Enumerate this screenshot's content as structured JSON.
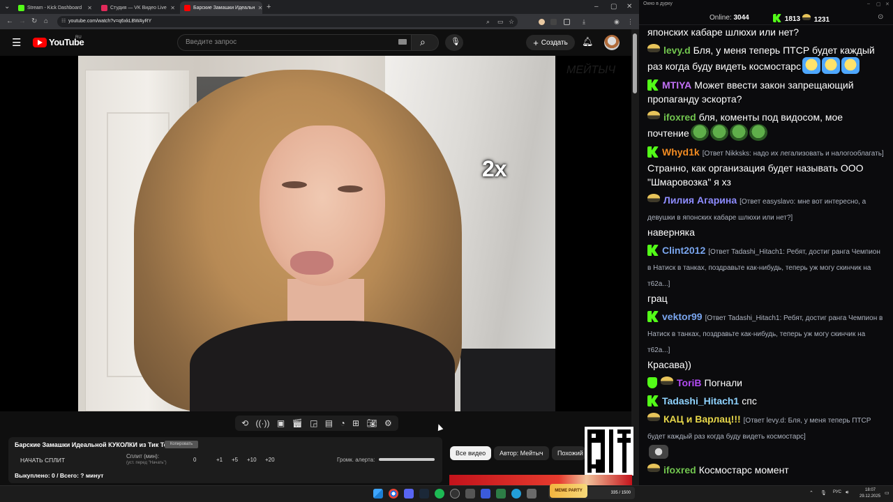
{
  "browser": {
    "tabs": [
      {
        "title": "Stream - Kick Dashboard",
        "favicon_color": "#53fc18",
        "active": false
      },
      {
        "title": "Студия — VK Видео Live",
        "favicon_color": "#e02a5a",
        "active": false
      },
      {
        "title": "Барские Замашки Идеальн",
        "favicon_color": "#ff0000",
        "active": true
      }
    ],
    "url": "youtube.com/watch?v=q6xkLBWAyRY",
    "new_tab_symbol": "+"
  },
  "youtube": {
    "logo_text": "YouTube",
    "logo_region": "RU",
    "search_placeholder": "Введите запрос",
    "create_label": "Создать",
    "video_overlay": {
      "speed_label": "2x",
      "watermark": "MEЙTЫЧ"
    },
    "split_panel": {
      "title": "Барские Замашки Идеальной КУКОЛКИ из Тик Ток",
      "copy_label": "Копировать",
      "start_label": "НАЧАТЬ СПЛИТ",
      "split_label": "Сплит (мин):",
      "split_hint": "(уст. перед \"Начать\")",
      "split_value": "0",
      "increments": [
        "+1",
        "+5",
        "+10",
        "+20"
      ],
      "volume_label": "Громк. алерта:",
      "volume_level": 1.0,
      "status": "Выкуплено: 0 / Всего: ? минут"
    },
    "chips": [
      "Все видео",
      "Автор: Мейтыч",
      "Похожий контент"
    ]
  },
  "chat": {
    "window_title": "Окно в дурку",
    "online_label": "Online:",
    "online_count": "3044",
    "kick_count": "1813",
    "vk_count": "1231",
    "messages": [
      {
        "badge": "none",
        "name": "",
        "color": "#ffffff",
        "reply": "",
        "text": "японских кабаре шлюхи или нет?",
        "emotes": []
      },
      {
        "badge": "hat",
        "name": "levy.d",
        "color": "#72c64f",
        "reply": "",
        "text": "Бля, у меня теперь ПТСР будет каждый раз когда буду видеть космостарс",
        "emotes": [
          "cosmo",
          "cosmo",
          "cosmo"
        ]
      },
      {
        "badge": "k",
        "name": "MTIYA",
        "color": "#c271f6",
        "reply": "",
        "text": "Может ввести закон запрещающий пропаганду эскорта?",
        "emotes": []
      },
      {
        "badge": "hat",
        "name": "ifoxred",
        "color": "#72c64f",
        "reply": "",
        "text": "бля, коменты под видосом, мое почтение",
        "emotes": [
          "frog",
          "frog",
          "frog",
          "frog"
        ]
      },
      {
        "badge": "k",
        "name": "Whyd1k",
        "color": "#f28b21",
        "reply": "[Ответ Nikksks: надо их легализовать и налогооблагать]",
        "text": "Странно, как организация будет называть ООО \"Шмаровозка\" я хз",
        "emotes": []
      },
      {
        "badge": "hat",
        "name": "Лилия Агарина",
        "color": "#8e8cff",
        "reply": "[Ответ easyslavo: мне вот интересно, а девушки в японских кабаре шлюхи или нет?]",
        "text": "наверняка",
        "emotes": []
      },
      {
        "badge": "k",
        "name": "Clint2012",
        "color": "#7aa6ef",
        "reply": "[Ответ Tadashi_Hitach1: Ребят, достиг ранга Чемпион в Натиск в танках, поздравьте как-нибудь, теперь уж могу скинчик на т62а...]",
        "text": "грац",
        "emotes": []
      },
      {
        "badge": "k",
        "name": "vektor99",
        "color": "#7aa6ef",
        "reply": "[Ответ Tadashi_Hitach1: Ребят, достиг ранга Чемпион в Натиск в танках, поздравьте как-нибудь, теперь уж могу скинчик на т62а...]",
        "text": "Красава))",
        "emotes": []
      },
      {
        "badge": "shield+hat",
        "name": "ToriB",
        "color": "#b24bf3",
        "reply": "",
        "text": "Погнали",
        "emotes": []
      },
      {
        "badge": "k",
        "name": "Tadashi_Hitach1",
        "color": "#8fd3ff",
        "reply": "",
        "text": "спс",
        "emotes": []
      },
      {
        "badge": "hat",
        "name": "КАЦ и Варлац!!!",
        "color": "#e8d84a",
        "reply": "[Ответ levy.d: Бля, у меня теперь ПТСР будет каждый раз когда буду видеть космостарс]",
        "text": "",
        "emotes": [
          "cat"
        ]
      },
      {
        "badge": "hat",
        "name": "ifoxred",
        "color": "#72c64f",
        "reply": "",
        "text": "Космостарс момент",
        "emotes": []
      }
    ]
  },
  "taskbar": {
    "promo_label": "MEME PARTY",
    "promo_counter": "335 / 1500",
    "lang": "РУС",
    "time": "18:07",
    "date": "29.12.2025"
  },
  "colors": {
    "kick_green": "#53fc18",
    "youtube_red": "#ff0000"
  }
}
